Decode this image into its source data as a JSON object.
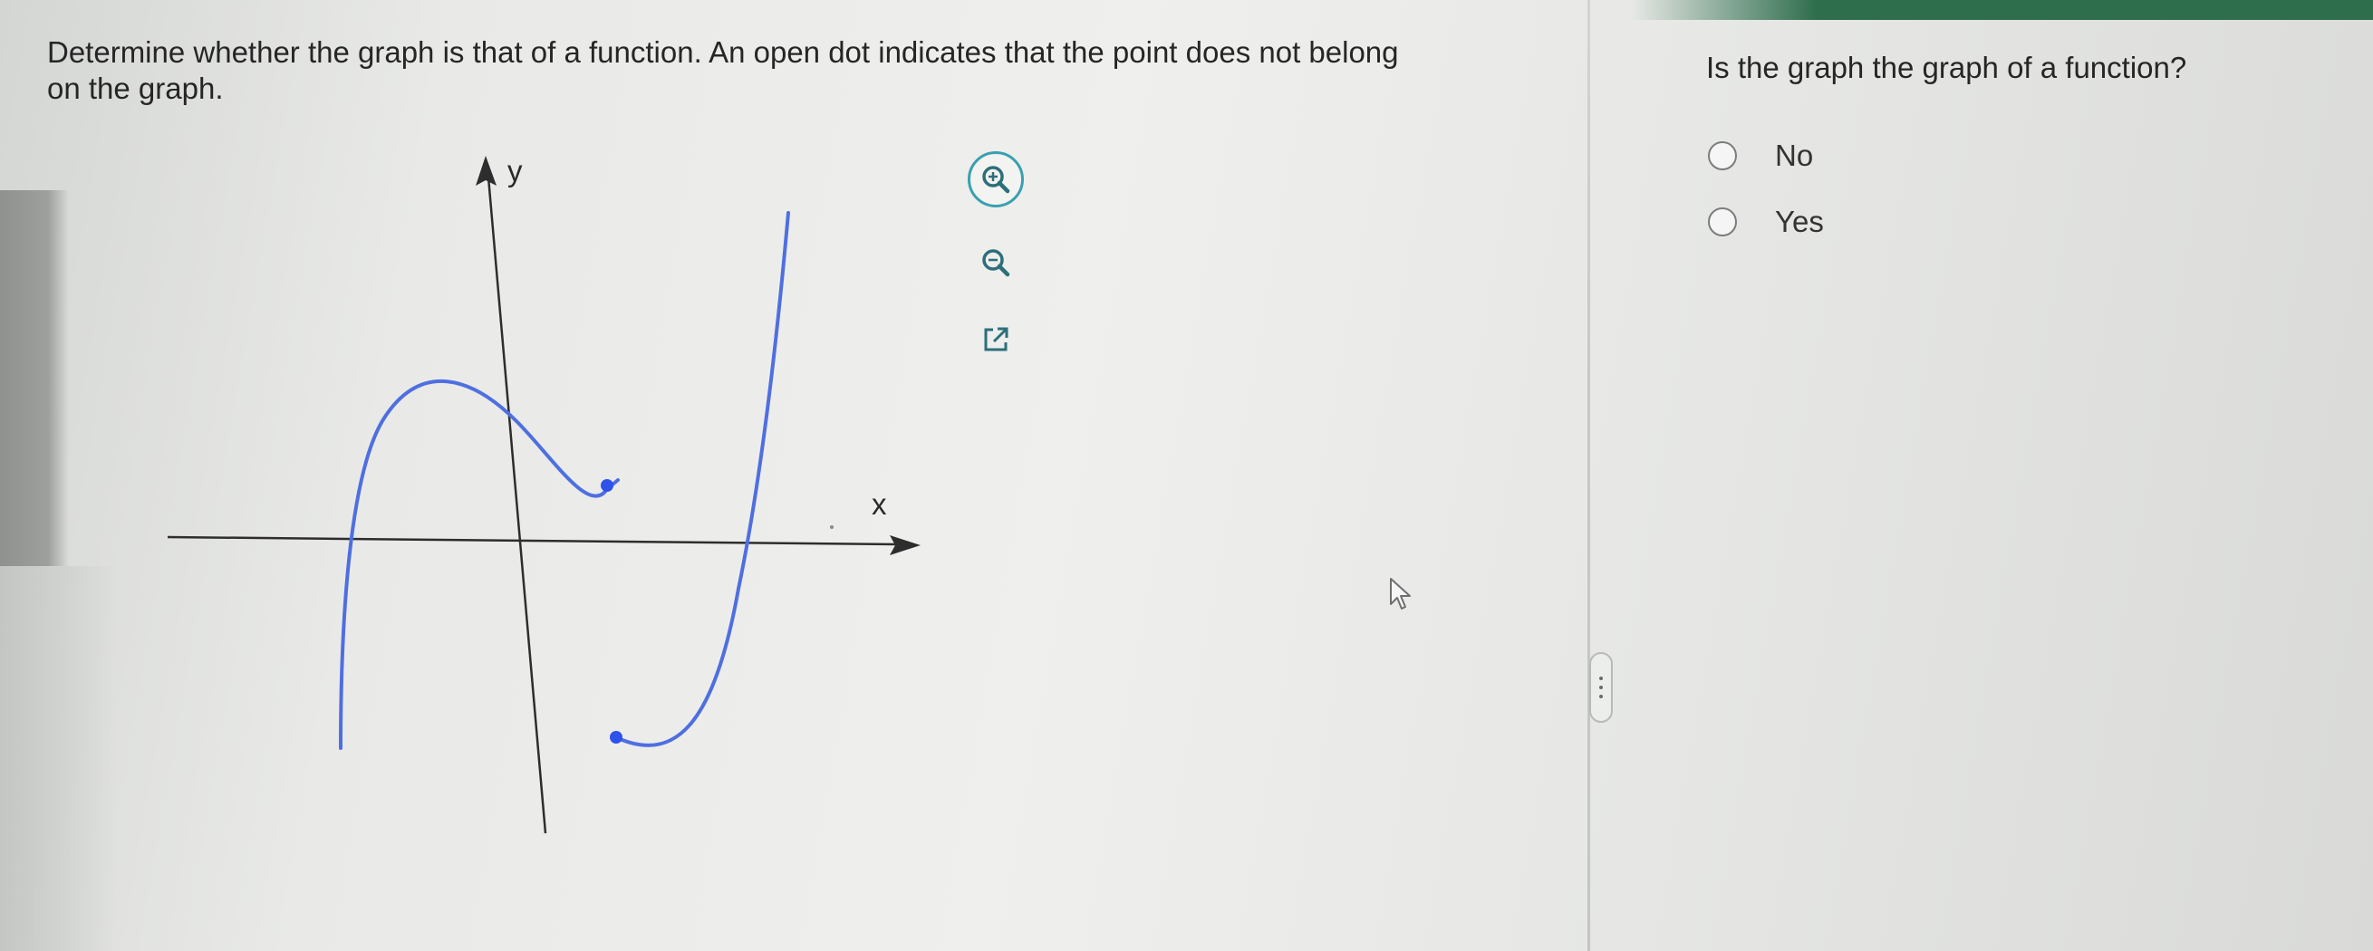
{
  "question": {
    "line1": "Determine whether the graph is that of a function. An open dot indicates that the point does not belong",
    "line2": "on the graph."
  },
  "graph": {
    "x_label": "x",
    "y_label": "y",
    "curve_color": "#4f6fe0",
    "axis_color": "#2d2d2d"
  },
  "tools": {
    "zoom_in_icon": "zoom-in-icon",
    "zoom_out_icon": "zoom-out-icon",
    "popout_icon": "external-link-icon",
    "accent_color": "#3aa0b0"
  },
  "answer": {
    "prompt": "Is the graph the graph of a function?",
    "options": [
      {
        "label": "No",
        "selected": false
      },
      {
        "label": "Yes",
        "selected": false
      }
    ]
  }
}
